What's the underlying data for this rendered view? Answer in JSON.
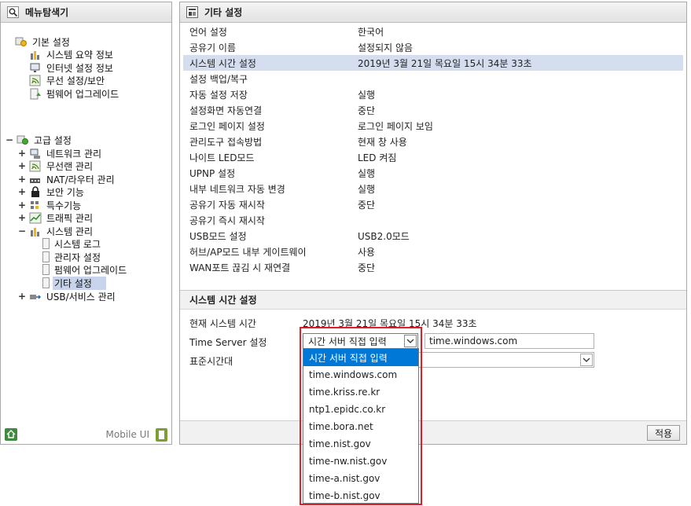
{
  "left_panel": {
    "title": "메뉴탐색기",
    "basic_group": {
      "label": "기본 설정",
      "items": [
        "시스템 요약 정보",
        "인터넷 설정 정보",
        "무선 설정/보안",
        "펌웨어 업그레이드"
      ]
    },
    "advanced_group": {
      "label": "고급 설정",
      "items": [
        "네트워크 관리",
        "무선랜 관리",
        "NAT/라우터 관리",
        "보안 기능",
        "특수기능",
        "트래픽 관리",
        "시스템 관리"
      ],
      "system_children": [
        "시스템 로그",
        "관리자 설정",
        "펌웨어 업그레이드",
        "기타 설정"
      ],
      "usb": "USB/서비스 관리"
    },
    "footer": {
      "mobile_label": "Mobile UI"
    }
  },
  "right_panel": {
    "title": "기타 설정",
    "settings": [
      {
        "name": "언어 설정",
        "value": "한국어"
      },
      {
        "name": "공유기 이름",
        "value": "설정되지 않음"
      },
      {
        "name": "시스템 시간 설정",
        "value": "2019년 3월 21일 목요일 15시 34분 33초"
      },
      {
        "name": "설정 백업/복구",
        "value": ""
      },
      {
        "name": "자동 설정 저장",
        "value": "실행"
      },
      {
        "name": "설정화면 자동연결",
        "value": "중단"
      },
      {
        "name": "로그인 페이지 설정",
        "value": "로그인 페이지 보임"
      },
      {
        "name": "관리도구 접속방법",
        "value": "현재 창 사용"
      },
      {
        "name": "나이트 LED모드",
        "value": "LED 켜짐"
      },
      {
        "name": "UPNP 설정",
        "value": "실행"
      },
      {
        "name": "내부 네트워크 자동 변경",
        "value": "실행"
      },
      {
        "name": "공유기 자동 재시작",
        "value": "중단"
      },
      {
        "name": "공유기 즉시 재시작",
        "value": ""
      },
      {
        "name": "USB모드 설정",
        "value": "USB2.0모드"
      },
      {
        "name": "허브/AP모드 내부 게이트웨이",
        "value": "사용"
      },
      {
        "name": "WAN포트 끊김 시 재연결",
        "value": "중단"
      }
    ],
    "detail": {
      "title": "시스템 시간 설정",
      "current_time_label": "현재 시스템 시간",
      "current_time_value": "2019년 3월 21일 목요일 15시 34분 33초",
      "time_server_label": "Time Server 설정",
      "time_server_selected": "시간 서버 직접 입력",
      "time_server_input": "time.windows.com",
      "timezone_label": "표준시간대"
    },
    "apply_label": "적용"
  },
  "dropdown": {
    "options": [
      "시간 서버 직접 입력",
      "time.windows.com",
      "time.kriss.re.kr",
      "ntp1.epidc.co.kr",
      "time.bora.net",
      "time.nist.gov",
      "time-nw.nist.gov",
      "time-a.nist.gov",
      "time-b.nist.gov"
    ],
    "selected_index": 0
  },
  "colors": {
    "highlight_row": "#d5deee",
    "selected_option": "#0078d7",
    "annotation_border": "#e01e2a"
  }
}
